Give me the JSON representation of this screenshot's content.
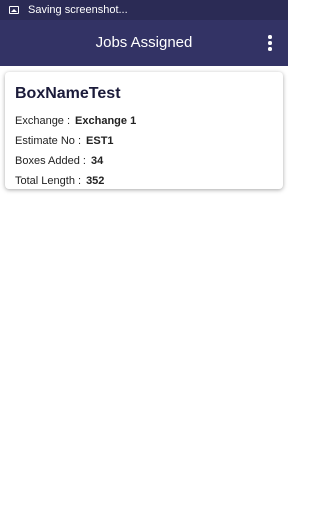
{
  "status_bar": {
    "text": "Saving screenshot..."
  },
  "app_bar": {
    "title": "Jobs Assigned"
  },
  "jobs": [
    {
      "name": "BoxNameTest",
      "exchange_label": "Exchange :",
      "exchange_value": "Exchange 1",
      "estimate_label": "Estimate No :",
      "estimate_value": "EST1",
      "boxes_label": "Boxes Added :",
      "boxes_value": "34",
      "length_label": "Total Length :",
      "length_value": "352"
    }
  ],
  "colors": {
    "status_bar": "#2b2b55",
    "app_bar": "#333365",
    "card_title": "#1b1b3a"
  },
  "icons": {
    "status": "image-icon",
    "menu": "more-vert-icon"
  }
}
